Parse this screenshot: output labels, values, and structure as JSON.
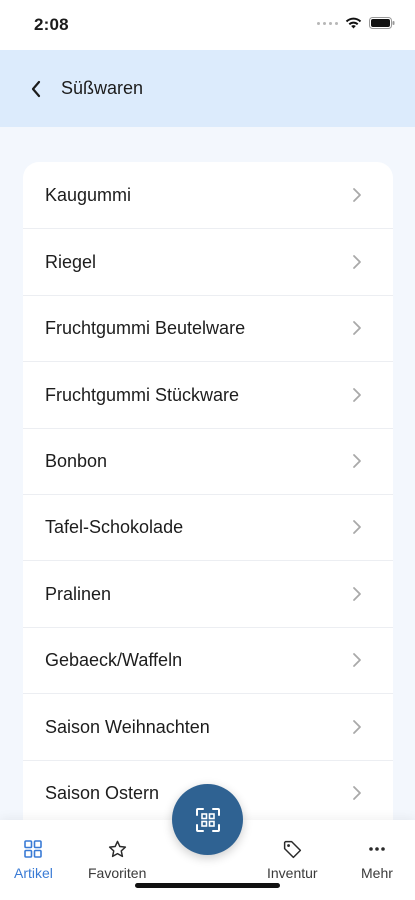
{
  "status_bar": {
    "time": "2:08"
  },
  "header": {
    "title": "Süßwaren",
    "back_icon": "chevron-left-icon"
  },
  "list": {
    "items": [
      {
        "label": "Kaugummi"
      },
      {
        "label": "Riegel"
      },
      {
        "label": "Fruchtgummi Beutelware"
      },
      {
        "label": "Fruchtgummi Stückware"
      },
      {
        "label": "Bonbon"
      },
      {
        "label": "Tafel-Schokolade"
      },
      {
        "label": "Pralinen"
      },
      {
        "label": "Gebaeck/Waffeln"
      },
      {
        "label": "Saison Weihnachten"
      },
      {
        "label": "Saison Ostern"
      }
    ]
  },
  "bottom_nav": {
    "items": [
      {
        "label": "Artikel",
        "icon": "grid-icon",
        "active": true
      },
      {
        "label": "Favoriten",
        "icon": "star-icon",
        "active": false
      },
      {
        "label": "Inventur",
        "icon": "tag-icon",
        "active": false
      },
      {
        "label": "Mehr",
        "icon": "more-icon",
        "active": false
      }
    ],
    "fab_icon": "scan-icon"
  },
  "colors": {
    "header_bg": "#dcebfc",
    "page_bg": "#f3f7fd",
    "accent": "#3a7bd5",
    "fab_bg": "#2f6292"
  }
}
